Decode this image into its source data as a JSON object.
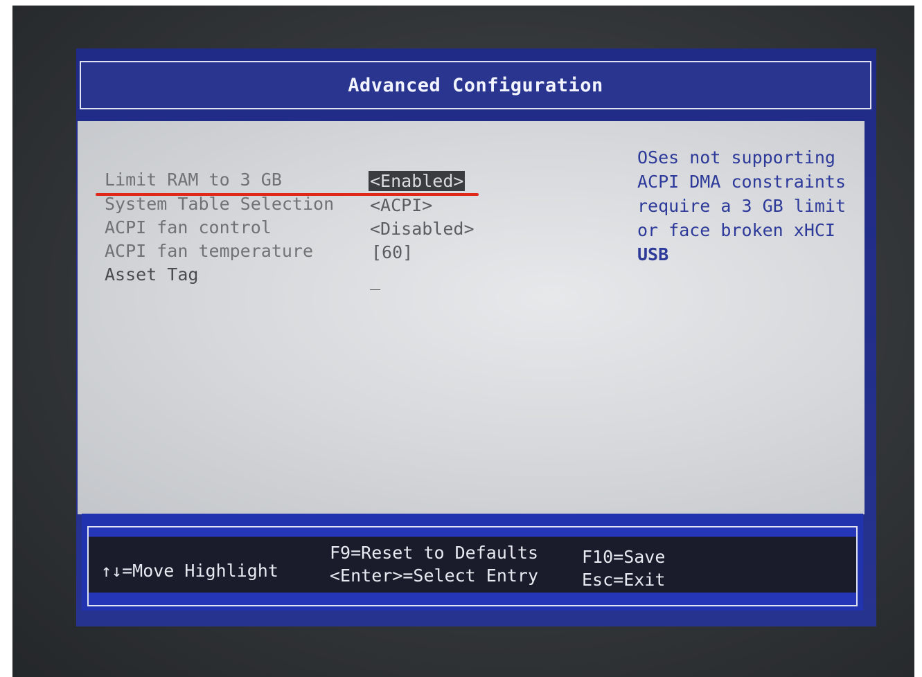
{
  "title": "Advanced Configuration",
  "options": [
    {
      "label": "Limit RAM to 3 GB",
      "value": "<Enabled>"
    },
    {
      "label": "System Table Selection",
      "value": "<ACPI>"
    },
    {
      "label": "ACPI fan control",
      "value": "<Disabled>"
    },
    {
      "label": "ACPI fan temperature",
      "value": "[60]"
    },
    {
      "label": "Asset Tag",
      "value": "_"
    }
  ],
  "help": [
    "OSes not supporting",
    "ACPI DMA constraints",
    "require a 3 GB limit",
    "or face broken xHCI",
    "USB"
  ],
  "footer": {
    "move": "↑↓=Move Highlight",
    "reset": "F9=Reset to Defaults",
    "select": "<Enter>=Select Entry",
    "save": "F10=Save",
    "exit": "Esc=Exit"
  },
  "colors": {
    "frame_blue": "#26338f",
    "content_gray": "#d6d8db",
    "help_text": "#2d3a9a",
    "annotation_red": "#e0271c"
  }
}
